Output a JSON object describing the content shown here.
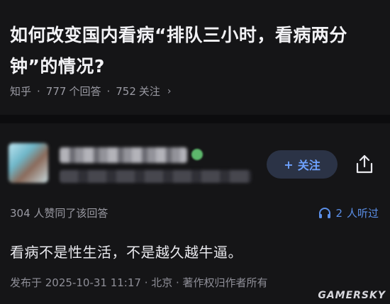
{
  "question": {
    "title": "如何改变国内看病“排队三小时，看病两分钟”的情况?",
    "source": "知乎",
    "answer_count": "777",
    "answer_count_suffix": "个回答",
    "follow_count": "752",
    "follow_suffix": "关注",
    "separator": "·",
    "chevron": "›"
  },
  "author": {
    "follow_plus": "+",
    "follow_label": "关注",
    "share_icon": "share-icon"
  },
  "answer": {
    "likes_text": "304 人赞同了该回答",
    "listen_count": "2",
    "listen_suffix": "人听过",
    "body": "看病不是性生活，不是越久越牛逼。",
    "publish_line": "发布于 2025-10-31 11:17 · 北京 · 著作权归作者所有"
  },
  "watermark": "GAMERSKY",
  "colors": {
    "background": "#151517",
    "accent": "#5b8fe8",
    "muted": "#9a9aa3"
  }
}
